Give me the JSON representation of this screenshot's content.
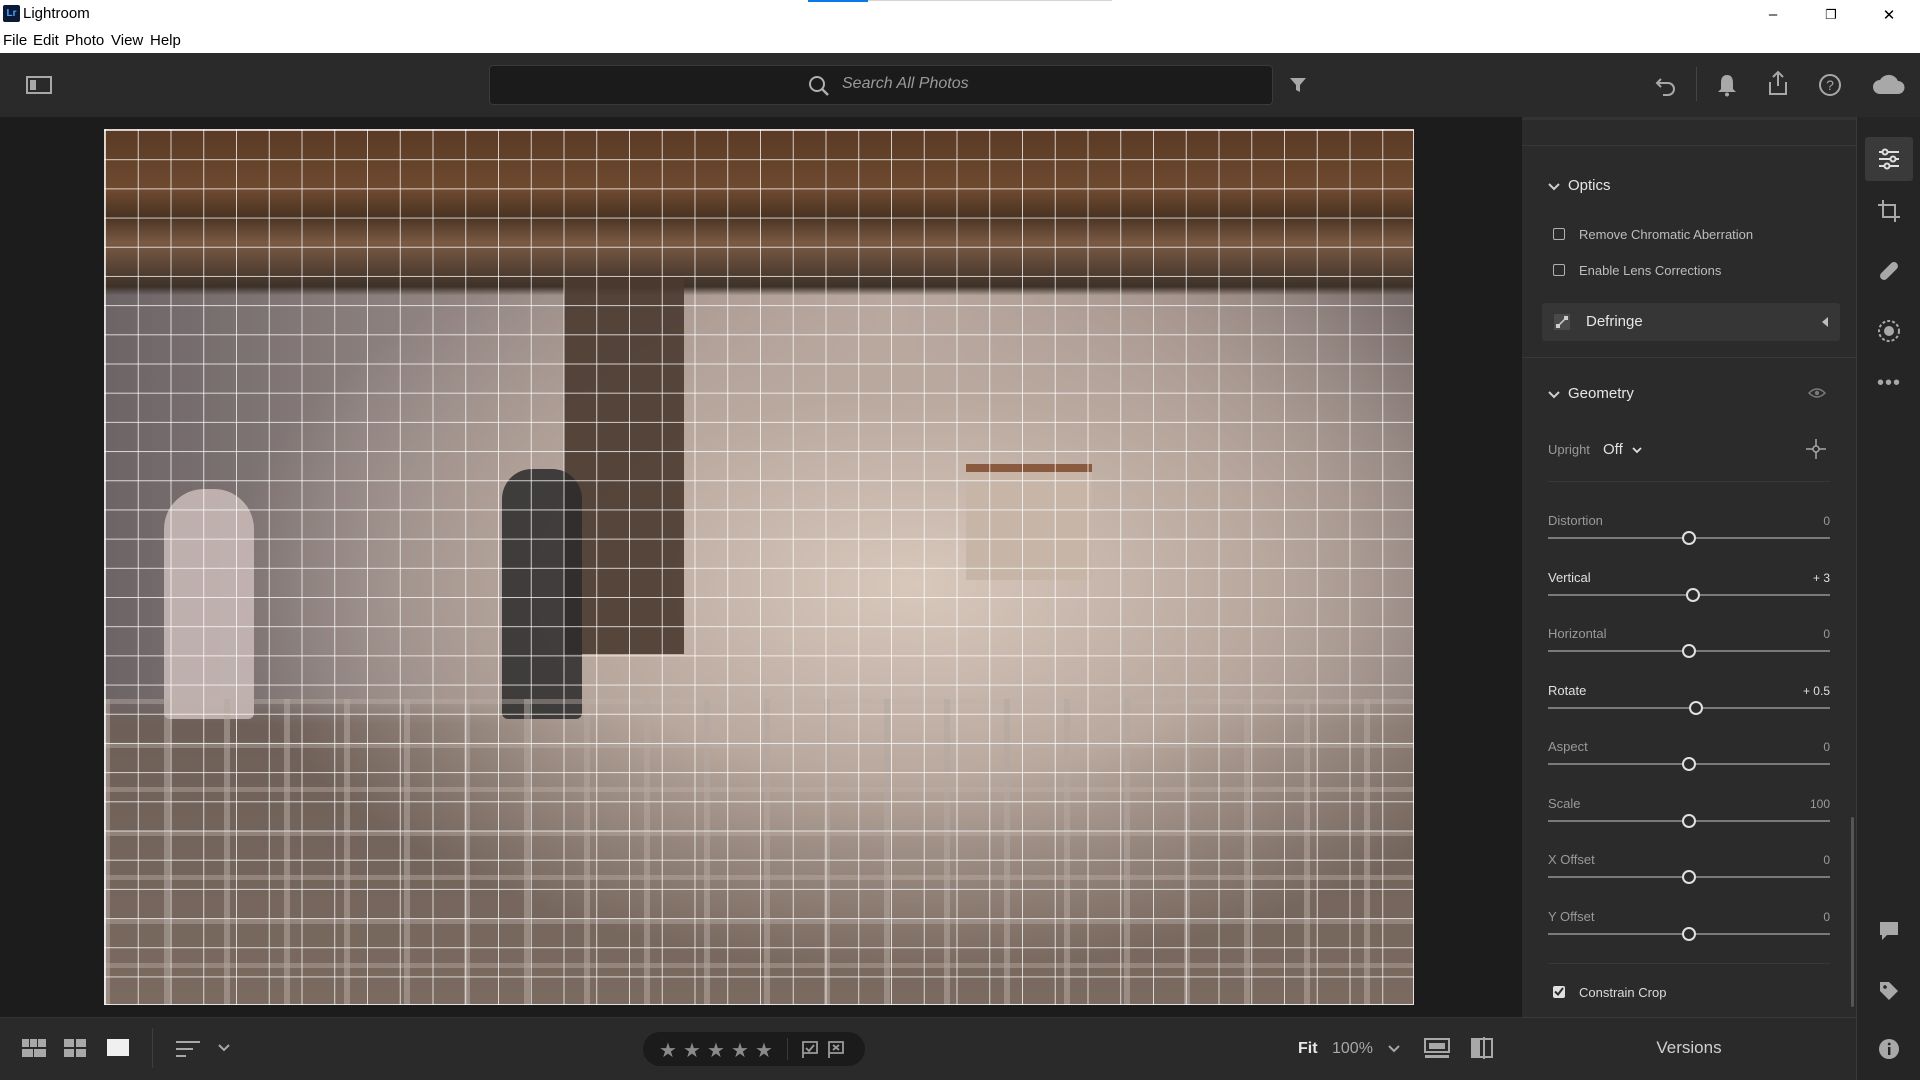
{
  "window": {
    "app_title": "Lightroom",
    "logo_text": "Lr",
    "controls": {
      "minimize": "–",
      "maximize": "❐",
      "close": "✕"
    }
  },
  "menu": [
    "File",
    "Edit",
    "Photo",
    "View",
    "Help"
  ],
  "toolbar": {
    "search_placeholder": "Search All Photos",
    "icons": [
      "panel-toggle-icon",
      "search-icon",
      "filter-icon",
      "undo-icon",
      "bell-icon",
      "share-icon",
      "help-icon",
      "cloud-icon"
    ]
  },
  "panel": {
    "optics": {
      "title": "Optics",
      "checkboxes": [
        {
          "label": "Remove Chromatic Aberration",
          "checked": false
        },
        {
          "label": "Enable Lens Corrections",
          "checked": false
        }
      ],
      "defringe": "Defringe"
    },
    "geometry": {
      "title": "Geometry",
      "upright_label": "Upright",
      "upright_value": "Off",
      "sliders": [
        {
          "label": "Distortion",
          "value": "0",
          "level": 0.5,
          "active": false
        },
        {
          "label": "Vertical",
          "value": "+ 3",
          "level": 0.515,
          "active": true
        },
        {
          "label": "Horizontal",
          "value": "0",
          "level": 0.5,
          "active": false
        },
        {
          "label": "Rotate",
          "value": "+ 0.5",
          "level": 0.525,
          "active": true
        },
        {
          "label": "Aspect",
          "value": "0",
          "level": 0.5,
          "active": false
        },
        {
          "label": "Scale",
          "value": "100",
          "level": 0.5,
          "active": false
        },
        {
          "label": "X Offset",
          "value": "0",
          "level": 0.5,
          "active": false
        },
        {
          "label": "Y Offset",
          "value": "0",
          "level": 0.5,
          "active": false
        }
      ],
      "constrain_crop": {
        "label": "Constrain Crop",
        "checked": true
      }
    }
  },
  "rail_icons": [
    "edit-sliders-icon",
    "crop-icon",
    "healing-icon",
    "masking-icon",
    "more-icon",
    "comment-icon",
    "tag-icon",
    "info-icon"
  ],
  "bottom": {
    "view_icons": [
      "photo-grid-icon",
      "square-grid-icon",
      "detail-view-icon",
      "sort-icon"
    ],
    "stars": [
      "★",
      "★",
      "★",
      "★",
      "★"
    ],
    "flags": [
      "pick-flag-icon",
      "reject-flag-icon"
    ],
    "fit_label": "Fit",
    "zoom_value": "100%",
    "versions_label": "Versions"
  }
}
